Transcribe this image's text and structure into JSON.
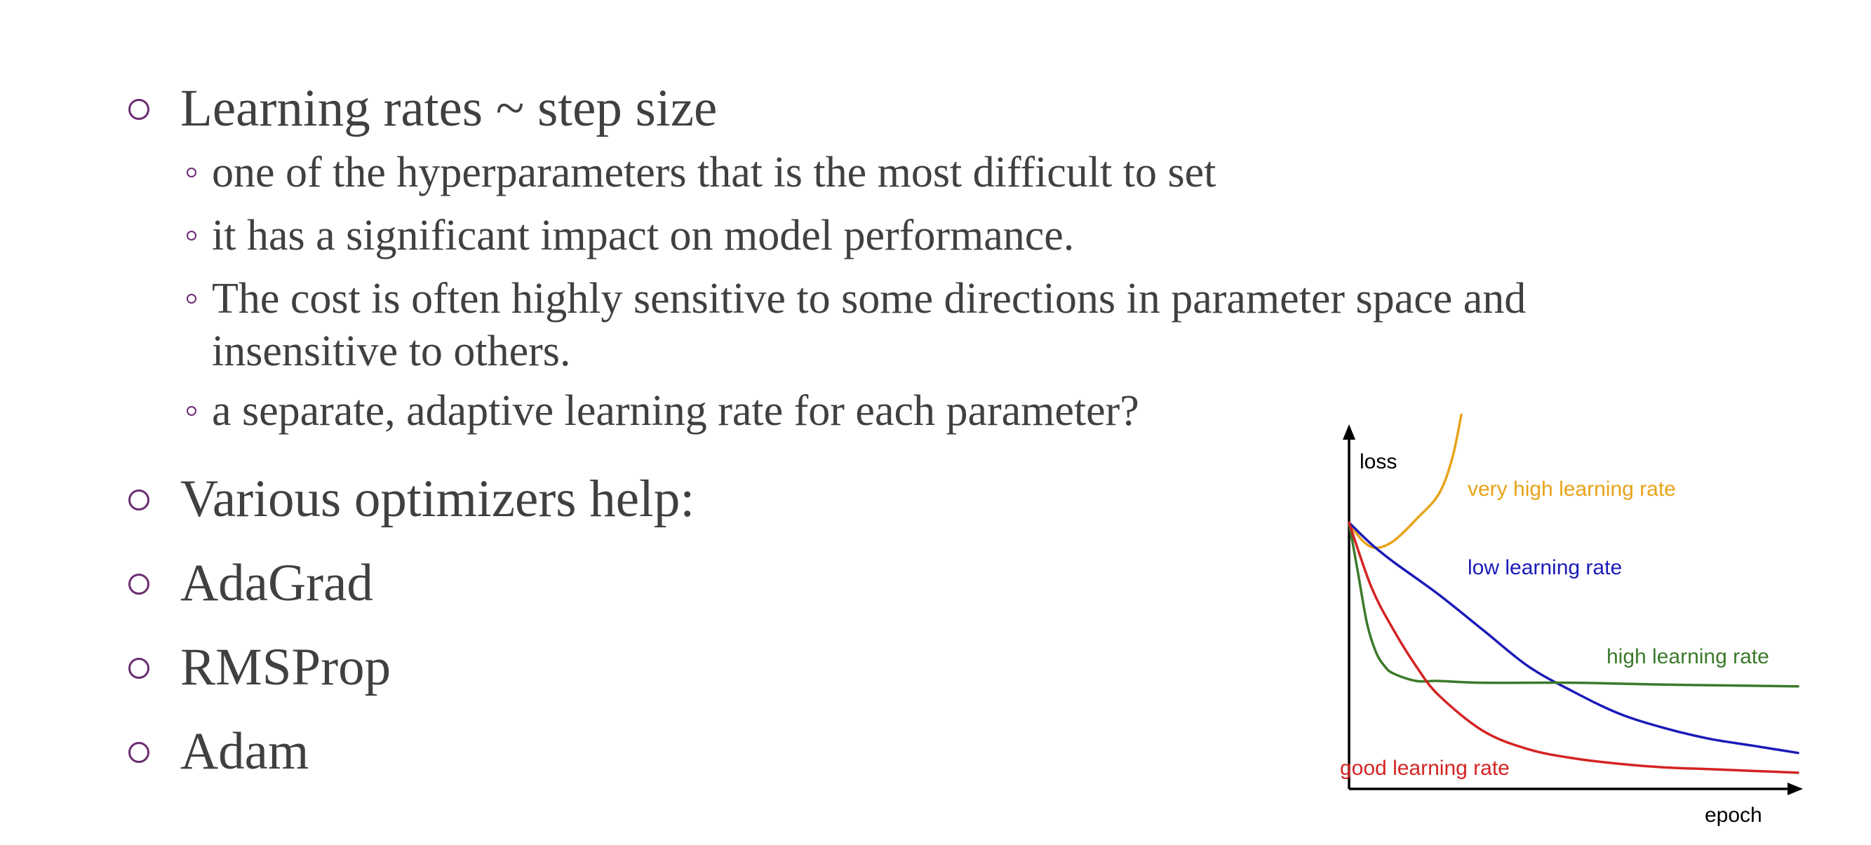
{
  "bullets": [
    {
      "text": "Learning rates ~ step size"
    },
    {
      "text": "one of the hyperparameters that is the most difficult to set"
    },
    {
      "text": "it has a significant impact on model performance."
    },
    {
      "text": "The cost is often highly sensitive to some directions in parameter space and"
    },
    {
      "text": "insensitive to others."
    },
    {
      "text": "a separate, adaptive learning rate for each parameter?"
    },
    {
      "text": "Various optimizers help:"
    },
    {
      "text": "AdaGrad"
    },
    {
      "text": "RMSProp"
    },
    {
      "text": "Adam"
    }
  ],
  "colors": {
    "bullet": "#6b2c72",
    "text": "#404040",
    "very_high": "#e8a317",
    "low": "#1a1ab8",
    "high": "#3b7a2a",
    "good": "#d42323",
    "axis": "#000000"
  },
  "chart_data": {
    "type": "line",
    "title": "",
    "xlabel": "epoch",
    "ylabel": "loss",
    "xlim": [
      0,
      100
    ],
    "ylim": [
      0,
      100
    ],
    "grid": false,
    "legend": "inline labels",
    "series": [
      {
        "name": "very high learning rate",
        "color": "#e8a317",
        "x": [
          0,
          3,
          6,
          10,
          15,
          20,
          23,
          25
        ],
        "y": [
          74,
          69,
          67,
          69,
          75,
          82,
          92,
          104
        ]
      },
      {
        "name": "low learning rate",
        "color": "#1a1ab8",
        "x": [
          0,
          5,
          10,
          20,
          30,
          40,
          50,
          60,
          70,
          80,
          90,
          100
        ],
        "y": [
          74,
          68,
          63,
          54,
          44,
          34,
          27,
          21,
          17,
          14,
          12,
          10
        ]
      },
      {
        "name": "high learning rate",
        "color": "#3b7a2a",
        "x": [
          0,
          2,
          4,
          6,
          8,
          10,
          15,
          20,
          30,
          50,
          70,
          100
        ],
        "y": [
          74,
          60,
          46,
          38,
          34,
          32,
          30,
          30,
          29.5,
          29.5,
          29,
          28.5
        ]
      },
      {
        "name": "good learning rate",
        "color": "#d42323",
        "x": [
          0,
          5,
          10,
          15,
          20,
          30,
          40,
          50,
          60,
          70,
          80,
          90,
          100
        ],
        "y": [
          74,
          56,
          44,
          34,
          26,
          16,
          11,
          8.5,
          7,
          6,
          5.5,
          5,
          4.5
        ]
      }
    ]
  }
}
